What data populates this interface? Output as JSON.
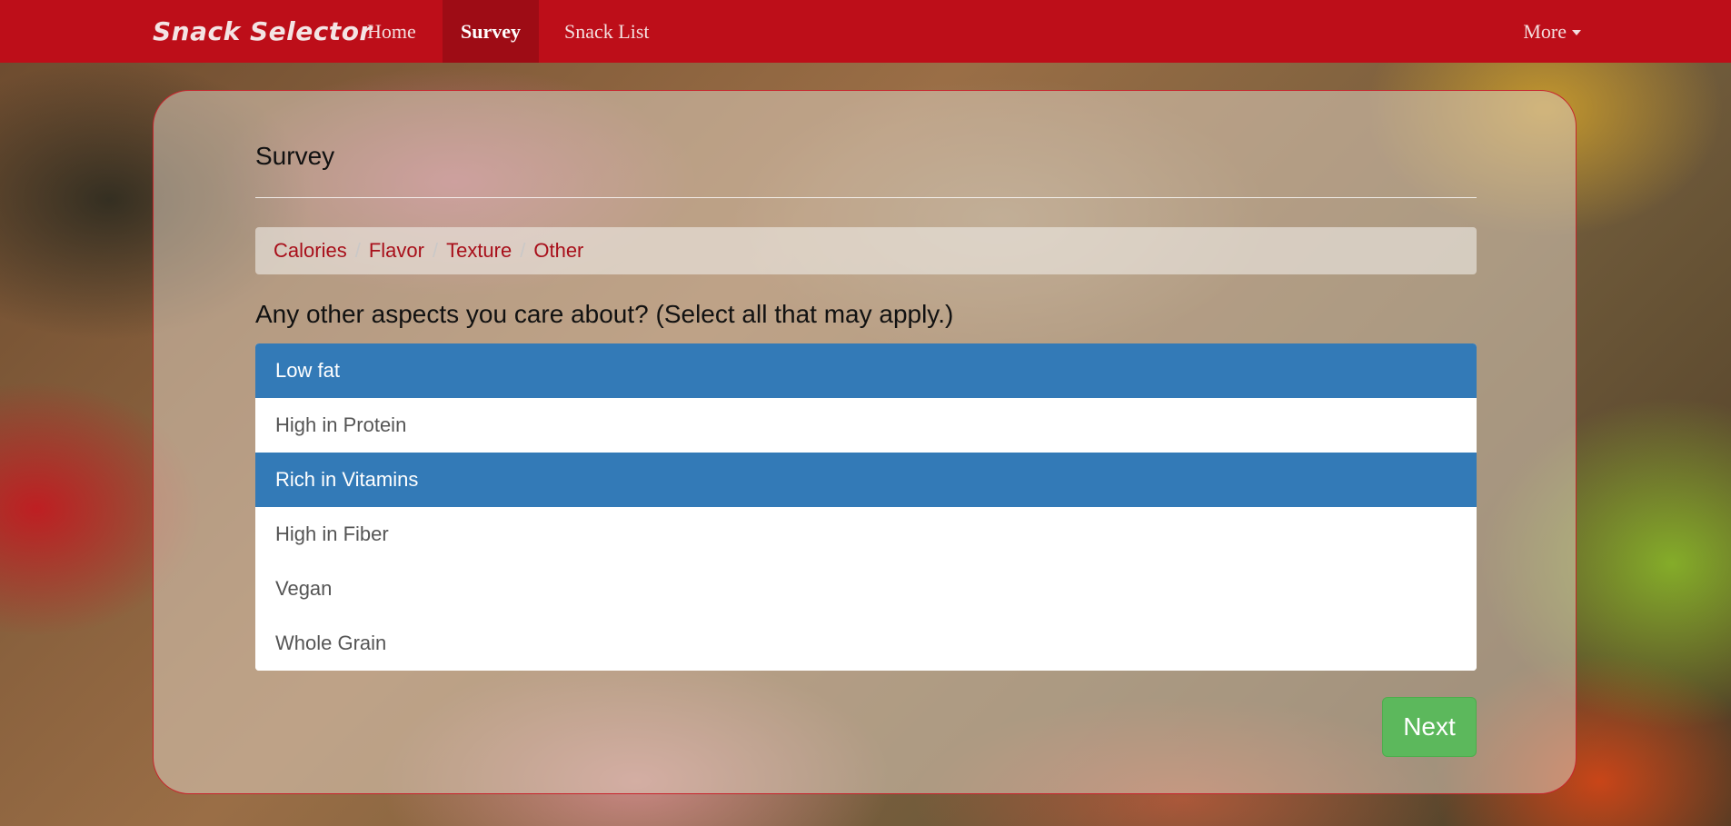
{
  "navbar": {
    "brand": "Snack Selector",
    "links": [
      {
        "label": "Home",
        "active": false
      },
      {
        "label": "Survey",
        "active": true
      },
      {
        "label": "Snack List",
        "active": false
      }
    ],
    "more_label": "More",
    "color": "#bd0e19"
  },
  "survey": {
    "title": "Survey",
    "breadcrumb": [
      "Calories",
      "Flavor",
      "Texture",
      "Other"
    ],
    "question": "Any other aspects you care about? (Select all that may apply.)",
    "options": [
      {
        "label": "Low fat",
        "selected": true
      },
      {
        "label": "High in Protein",
        "selected": false
      },
      {
        "label": "Rich in Vitamins",
        "selected": true
      },
      {
        "label": "High in Fiber",
        "selected": false
      },
      {
        "label": "Vegan",
        "selected": false
      },
      {
        "label": "Whole Grain",
        "selected": false
      }
    ],
    "next_label": "Next",
    "selected_color": "#337ab7",
    "next_color": "#5cb85c"
  }
}
